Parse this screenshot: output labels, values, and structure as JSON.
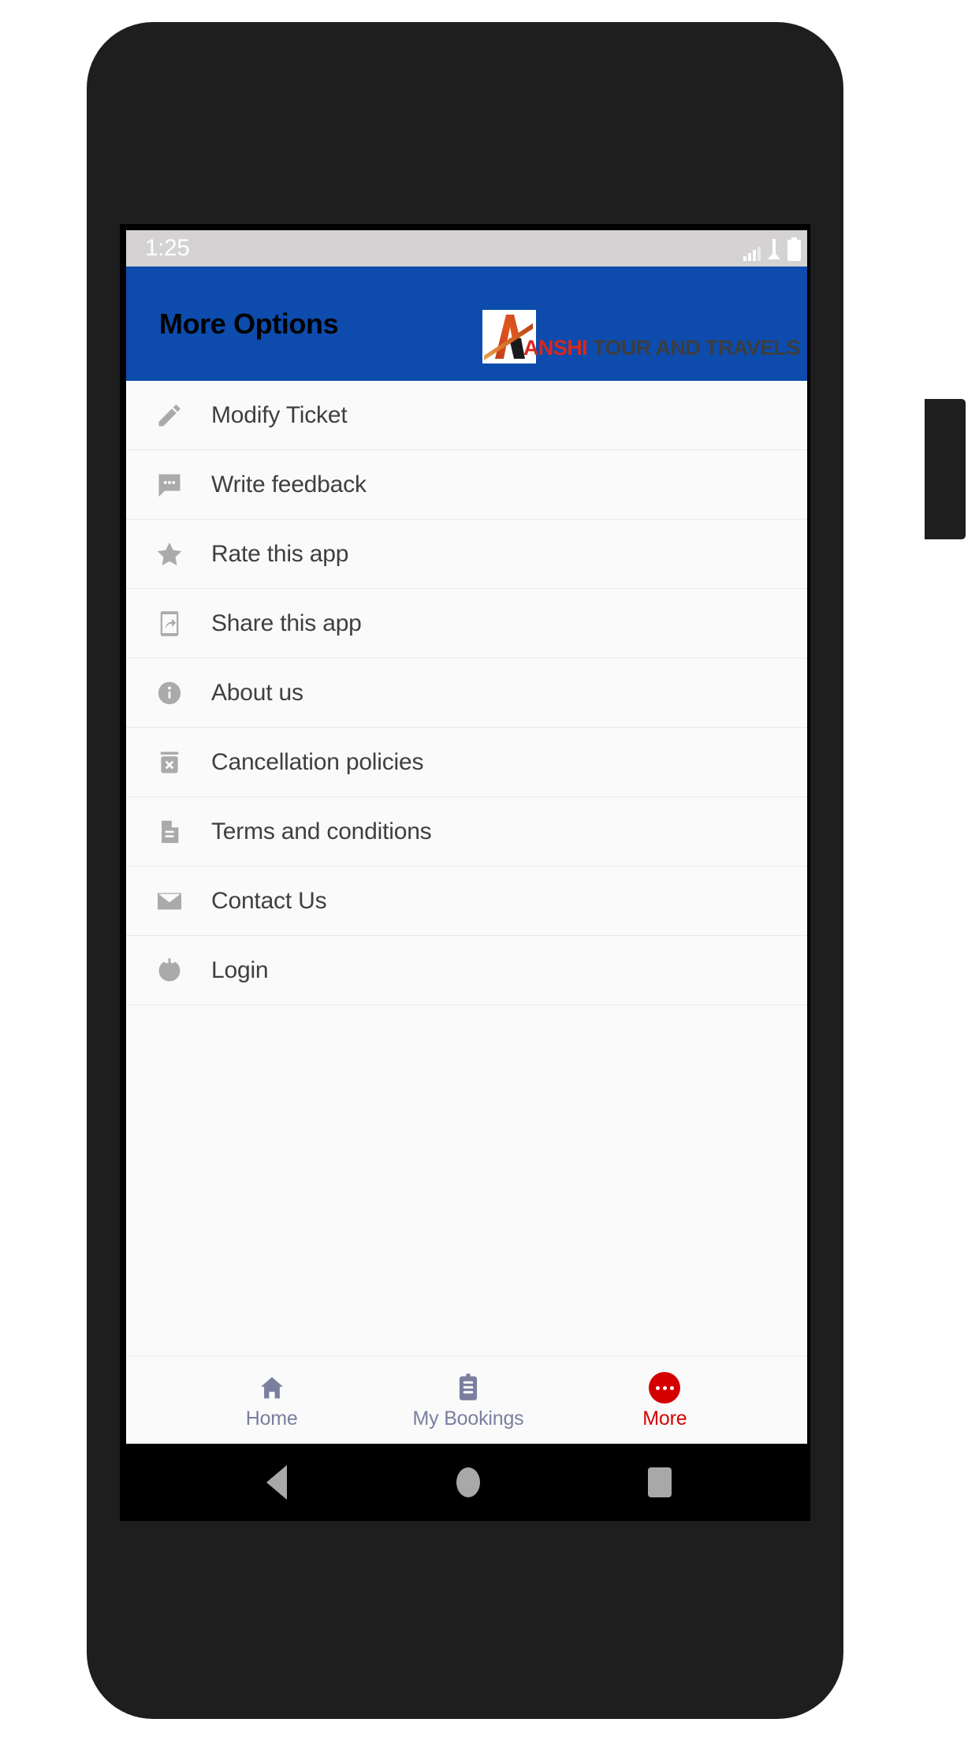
{
  "status_bar": {
    "time": "1:25",
    "icons": [
      "signal-icon",
      "network-icon",
      "battery-icon"
    ]
  },
  "header": {
    "title": "More Options",
    "background_color": "#0d4cad",
    "title_color": "#000000",
    "brand": {
      "logo_icon": "anshi-a-logo",
      "name_primary": "ANSHI",
      "name_secondary": " TOUR AND TRAVELS",
      "primary_color": "#d7281c",
      "secondary_color": "#3d3d3d"
    }
  },
  "options": [
    {
      "icon": "pencil-icon",
      "label": "Modify Ticket"
    },
    {
      "icon": "chat-bubble-icon",
      "label": "Write feedback"
    },
    {
      "icon": "star-icon",
      "label": "Rate this app"
    },
    {
      "icon": "share-phone-icon",
      "label": "Share this app"
    },
    {
      "icon": "info-circle-icon",
      "label": "About us"
    },
    {
      "icon": "trash-x-icon",
      "label": "Cancellation policies"
    },
    {
      "icon": "document-icon",
      "label": "Terms and conditions"
    },
    {
      "icon": "envelope-icon",
      "label": "Contact Us"
    },
    {
      "icon": "power-icon",
      "label": "Login"
    }
  ],
  "bottom_nav": {
    "items": [
      {
        "icon": "home-icon",
        "label": "Home",
        "active": false
      },
      {
        "icon": "clipboard-icon",
        "label": "My Bookings",
        "active": false
      },
      {
        "icon": "more-dots-icon",
        "label": "More",
        "active": true
      }
    ],
    "inactive_color": "#7b7f9e",
    "active_color": "#d40000"
  },
  "android_nav": {
    "back": "back-triangle-icon",
    "home": "home-circle-icon",
    "recents": "recents-square-icon"
  }
}
